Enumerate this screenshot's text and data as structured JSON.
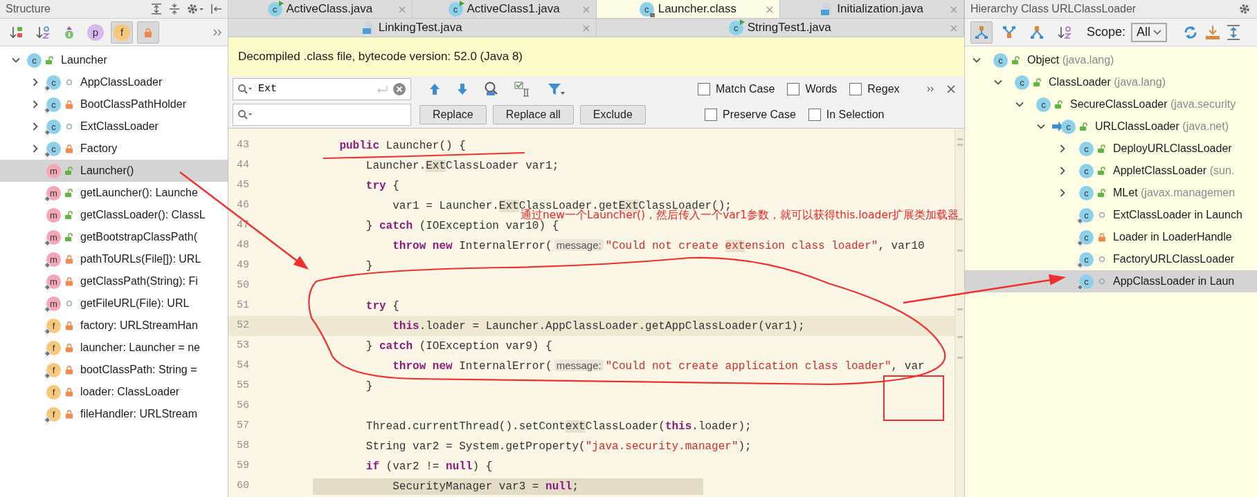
{
  "structure": {
    "title": "Structure",
    "toolbar": [
      {
        "kind": "sort-visibility",
        "on": false
      },
      {
        "kind": "sort-alpha",
        "on": false
      },
      {
        "kind": "inherited",
        "on": false
      },
      {
        "kind": "properties",
        "letter": "p",
        "on": false
      },
      {
        "kind": "fields",
        "letter": "f",
        "on": true
      },
      {
        "kind": "non-public",
        "on": true
      }
    ],
    "tree": [
      {
        "label": "Launcher",
        "kind": "class",
        "letter": "c",
        "public": true,
        "private": false,
        "static": false,
        "expanded": true,
        "selected": false,
        "children": [
          {
            "label": "AppClassLoader",
            "kind": "class",
            "letter": "c",
            "public": false,
            "private": false,
            "static": true,
            "expanded": false,
            "selected": false
          },
          {
            "label": "BootClassPathHolder",
            "kind": "class",
            "letter": "c",
            "public": false,
            "private": true,
            "static": true,
            "expanded": false,
            "selected": false
          },
          {
            "label": "ExtClassLoader",
            "kind": "class",
            "letter": "c",
            "public": false,
            "private": false,
            "static": true,
            "expanded": false,
            "selected": false
          },
          {
            "label": "Factory",
            "kind": "class",
            "letter": "c",
            "public": false,
            "private": true,
            "static": true,
            "expanded": false,
            "selected": false
          },
          {
            "label": "Launcher()",
            "kind": "method",
            "letter": "m",
            "public": true,
            "private": false,
            "static": false,
            "selected": true
          },
          {
            "label": "getLauncher(): Launche",
            "kind": "method",
            "letter": "m",
            "public": true,
            "private": false,
            "static": true,
            "selected": false
          },
          {
            "label": "getClassLoader(): ClassL",
            "kind": "method",
            "letter": "m",
            "public": true,
            "private": false,
            "static": false,
            "selected": false
          },
          {
            "label": "getBootstrapClassPath(",
            "kind": "method",
            "letter": "m",
            "public": true,
            "private": false,
            "static": true,
            "selected": false
          },
          {
            "label": "pathToURLs(File[]): URL",
            "kind": "method",
            "letter": "m",
            "public": false,
            "private": true,
            "static": true,
            "selected": false
          },
          {
            "label": "getClassPath(String): Fi",
            "kind": "method",
            "letter": "m",
            "public": false,
            "private": true,
            "static": true,
            "selected": false
          },
          {
            "label": "getFileURL(File): URL",
            "kind": "method",
            "letter": "m",
            "public": false,
            "private": false,
            "static": true,
            "selected": false
          },
          {
            "label": "factory: URLStreamHan",
            "kind": "field",
            "letter": "f",
            "public": false,
            "private": true,
            "static": true,
            "selected": false
          },
          {
            "label": "launcher: Launcher = ne",
            "kind": "field",
            "letter": "f",
            "public": false,
            "private": true,
            "static": true,
            "selected": false
          },
          {
            "label": "bootClassPath: String =",
            "kind": "field",
            "letter": "f",
            "public": false,
            "private": true,
            "static": true,
            "selected": false
          },
          {
            "label": "loader: ClassLoader",
            "kind": "field",
            "letter": "f",
            "public": false,
            "private": true,
            "static": false,
            "selected": false
          },
          {
            "label": "fileHandler: URLStream",
            "kind": "field",
            "letter": "f",
            "public": false,
            "private": true,
            "static": true,
            "selected": false
          }
        ]
      }
    ]
  },
  "editor": {
    "tab_rows": [
      [
        {
          "label": "ActiveClass.java",
          "kind": "runnable-class",
          "letter": "c",
          "selected": false
        },
        {
          "label": "ActiveClass1.java",
          "kind": "runnable-class",
          "letter": "c",
          "selected": false
        },
        {
          "label": "Launcher.class",
          "kind": "locked-class",
          "letter": "c",
          "selected": true
        },
        {
          "label": "Initialization.java",
          "kind": "java-file",
          "selected": false
        }
      ],
      [
        {
          "label": "LinkingTest.java",
          "kind": "java-file",
          "selected": false
        },
        {
          "label": "StringTest1.java",
          "kind": "runnable-class",
          "letter": "c",
          "selected": false
        }
      ]
    ],
    "banner": "Decompiled .class file, bytecode version: 52.0 (Java 8)",
    "find": {
      "search_value": "Ext",
      "buttons": [
        "Replace",
        "Replace all",
        "Exclude"
      ],
      "option_rows": [
        [
          {
            "label": "Match Case",
            "checked": false
          },
          {
            "label": "Words",
            "checked": false
          },
          {
            "label": "Regex",
            "checked": false
          }
        ],
        [
          {
            "label": "Preserve Case",
            "checked": false
          },
          {
            "label": "In Selection",
            "checked": false
          }
        ]
      ]
    },
    "code": [
      {
        "number": "43",
        "current": false,
        "highlighted": false,
        "tokens": [
          {
            "kind": "keyword",
            "text": "    public"
          },
          {
            "kind": "plain",
            "text": " Launcher() {"
          }
        ]
      },
      {
        "number": "44",
        "current": false,
        "highlighted": false,
        "tokens": [
          {
            "kind": "plain",
            "text": "        Launcher."
          },
          {
            "kind": "match",
            "text": "Ext"
          },
          {
            "kind": "plain",
            "text": "ClassLoader var1;"
          }
        ]
      },
      {
        "number": "45",
        "current": false,
        "highlighted": false,
        "tokens": [
          {
            "kind": "keyword",
            "text": "        try"
          },
          {
            "kind": "plain",
            "text": " {"
          }
        ]
      },
      {
        "number": "46",
        "current": false,
        "highlighted": false,
        "tokens": [
          {
            "kind": "plain",
            "text": "            var1 = Launcher."
          },
          {
            "kind": "match",
            "text": "Ext"
          },
          {
            "kind": "plain",
            "text": "ClassLoader.get"
          },
          {
            "kind": "match",
            "text": "Ext"
          },
          {
            "kind": "plain",
            "text": "ClassLoader();"
          }
        ]
      },
      {
        "number": "47",
        "current": false,
        "highlighted": false,
        "tokens": [
          {
            "kind": "plain",
            "text": "        } "
          },
          {
            "kind": "keyword",
            "text": "catch"
          },
          {
            "kind": "plain",
            "text": " (IOException var10) {"
          }
        ]
      },
      {
        "number": "48",
        "current": false,
        "highlighted": false,
        "tokens": [
          {
            "kind": "keyword",
            "text": "            throw new"
          },
          {
            "kind": "plain",
            "text": " InternalError("
          },
          {
            "kind": "hint",
            "text": "message:"
          },
          {
            "kind": "string",
            "text": "\"Could not create "
          },
          {
            "kind": "string-match",
            "text": "ext"
          },
          {
            "kind": "string",
            "text": "ension class loader\""
          },
          {
            "kind": "plain",
            "text": ", var10"
          }
        ]
      },
      {
        "number": "49",
        "current": false,
        "highlighted": false,
        "tokens": [
          {
            "kind": "plain",
            "text": "        }"
          }
        ]
      },
      {
        "number": "50",
        "current": false,
        "highlighted": false
      },
      {
        "number": "51",
        "current": false,
        "highlighted": false,
        "tokens": [
          {
            "kind": "keyword",
            "text": "        try"
          },
          {
            "kind": "plain",
            "text": " {"
          }
        ]
      },
      {
        "number": "52",
        "current": true,
        "highlighted": false,
        "tokens": [
          {
            "kind": "keyword",
            "text": "            this"
          },
          {
            "kind": "plain",
            "text": ".loader = Launcher.AppClassLoader.getAppClassLoader(var1);"
          }
        ]
      },
      {
        "number": "53",
        "current": false,
        "highlighted": false,
        "tokens": [
          {
            "kind": "plain",
            "text": "        } "
          },
          {
            "kind": "keyword",
            "text": "catch"
          },
          {
            "kind": "plain",
            "text": " (IOException var9) {"
          }
        ]
      },
      {
        "number": "54",
        "current": false,
        "highlighted": false,
        "tokens": [
          {
            "kind": "keyword",
            "text": "            throw new"
          },
          {
            "kind": "plain",
            "text": " InternalError("
          },
          {
            "kind": "hint",
            "text": "message:"
          },
          {
            "kind": "string",
            "text": "\"Could not create application class loader\""
          },
          {
            "kind": "plain",
            "text": ", var"
          }
        ]
      },
      {
        "number": "55",
        "current": false,
        "highlighted": false,
        "tokens": [
          {
            "kind": "plain",
            "text": "        }"
          }
        ]
      },
      {
        "number": "56",
        "current": false,
        "highlighted": false
      },
      {
        "number": "57",
        "current": false,
        "highlighted": false,
        "tokens": [
          {
            "kind": "plain",
            "text": "        Thread.currentThread().setCont"
          },
          {
            "kind": "match",
            "text": "ext"
          },
          {
            "kind": "plain",
            "text": "ClassLoader("
          },
          {
            "kind": "keyword",
            "text": "this"
          },
          {
            "kind": "plain",
            "text": ".loader);"
          }
        ]
      },
      {
        "number": "58",
        "current": false,
        "highlighted": false,
        "tokens": [
          {
            "kind": "plain",
            "text": "        String var2 = System.getProperty("
          },
          {
            "kind": "string",
            "text": "\"java.security.manager\""
          },
          {
            "kind": "plain",
            "text": ");"
          }
        ]
      },
      {
        "number": "59",
        "current": false,
        "highlighted": false,
        "tokens": [
          {
            "kind": "keyword",
            "text": "        if"
          },
          {
            "kind": "plain",
            "text": " (var2 != "
          },
          {
            "kind": "keyword",
            "text": "null"
          },
          {
            "kind": "plain",
            "text": ") {"
          }
        ]
      },
      {
        "number": "60",
        "current": false,
        "highlighted": true,
        "tokens": [
          {
            "kind": "plain",
            "text": "            SecurityManager var3 = "
          },
          {
            "kind": "keyword",
            "text": "null"
          },
          {
            "kind": "plain",
            "text": ";"
          }
        ]
      }
    ]
  },
  "hierarchy": {
    "title": "Hierarchy Class URLClassLoader",
    "toolbar": [
      {
        "kind": "type-hierarchy",
        "on": true
      },
      {
        "kind": "supertypes",
        "on": false
      },
      {
        "kind": "subtypes",
        "on": false
      },
      {
        "kind": "sort-alpha",
        "on": false
      }
    ],
    "scope_label": "Scope:",
    "scope": "All",
    "tree": [
      {
        "name": "Object",
        "package": "(java.lang)",
        "letter": "c",
        "public": true,
        "private": false,
        "static": false,
        "current": false,
        "expanded": true,
        "selected": false,
        "children": [
          {
            "name": "ClassLoader",
            "package": "(java.lang)",
            "letter": "c",
            "public": true,
            "private": false,
            "static": false,
            "current": false,
            "expanded": true,
            "selected": false,
            "children": [
              {
                "name": "SecureClassLoader",
                "package": "(java.security",
                "letter": "c",
                "public": true,
                "private": false,
                "static": false,
                "current": false,
                "expanded": true,
                "selected": false,
                "children": [
                  {
                    "name": "URLClassLoader",
                    "package": "(java.net)",
                    "letter": "c",
                    "public": true,
                    "private": false,
                    "static": false,
                    "current": true,
                    "expanded": true,
                    "selected": false,
                    "children": [
                      {
                        "name": "DeployURLClassLoader",
                        "letter": "c",
                        "public": true,
                        "private": false,
                        "static": false,
                        "current": false,
                        "expanded": false,
                        "selected": false
                      },
                      {
                        "name": "AppletClassLoader",
                        "package": "(sun.",
                        "letter": "c",
                        "public": true,
                        "private": false,
                        "static": false,
                        "current": false,
                        "expanded": false,
                        "selected": false
                      },
                      {
                        "name": "MLet",
                        "package": "(javax.managemen",
                        "letter": "c",
                        "public": true,
                        "private": false,
                        "static": false,
                        "current": false,
                        "expanded": false,
                        "selected": false
                      },
                      {
                        "name": "ExtClassLoader in Launch",
                        "letter": "c",
                        "public": false,
                        "private": false,
                        "static": true,
                        "current": false,
                        "selected": false
                      },
                      {
                        "name": "Loader in LoaderHandle",
                        "letter": "c",
                        "public": false,
                        "private": true,
                        "static": true,
                        "current": false,
                        "selected": false
                      },
                      {
                        "name": "FactoryURLClassLoader",
                        "letter": "c",
                        "public": false,
                        "private": false,
                        "static": true,
                        "current": false,
                        "selected": false
                      },
                      {
                        "name": "AppClassLoader in Laun",
                        "letter": "c",
                        "public": false,
                        "private": false,
                        "static": true,
                        "current": false,
                        "selected": true
                      }
                    ]
                  }
                ]
              }
            ]
          }
        ]
      }
    ]
  },
  "annotation": {
    "text": "通过new一个Launcher()，然后传入一个var1参数，就可以获得this.loader扩展类加载器"
  }
}
